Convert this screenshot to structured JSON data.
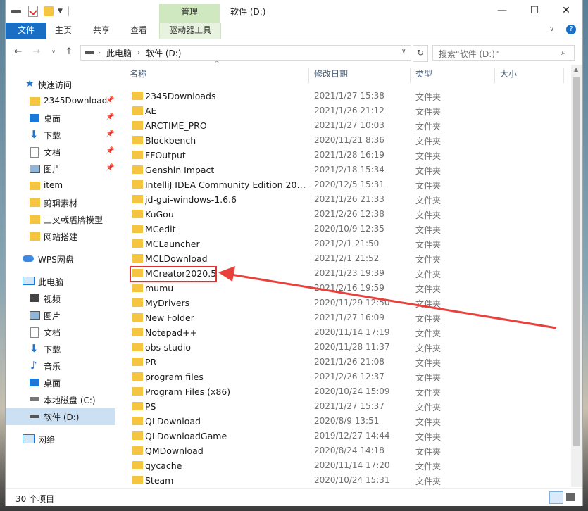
{
  "window": {
    "title": "软件 (D:)",
    "context_tab": "管理",
    "controls": {
      "minimize": "—",
      "maximize": "☐",
      "close": "✕"
    }
  },
  "ribbon": {
    "file": "文件",
    "tabs": [
      "主页",
      "共享",
      "查看"
    ],
    "context_tool": "驱动器工具"
  },
  "address": {
    "path": [
      "此电脑",
      "软件 (D:)"
    ],
    "search_placeholder": "搜索\"软件 (D:)\""
  },
  "nav": {
    "quick_access": "快速访问",
    "quick_items": [
      {
        "label": "2345Download",
        "pinned": true
      },
      {
        "label": "桌面",
        "pinned": true
      },
      {
        "label": "下载",
        "pinned": true
      },
      {
        "label": "文档",
        "pinned": true
      },
      {
        "label": "图片",
        "pinned": true
      },
      {
        "label": "item",
        "pinned": false
      },
      {
        "label": "剪辑素材",
        "pinned": false
      },
      {
        "label": "三叉戟盾牌模型",
        "pinned": false
      },
      {
        "label": "网站搭建",
        "pinned": false
      }
    ],
    "wps": "WPS网盘",
    "this_pc": "此电脑",
    "pc_items": [
      "视频",
      "图片",
      "文档",
      "下载",
      "音乐",
      "桌面",
      "本地磁盘 (C:)",
      "软件 (D:)"
    ],
    "network": "网络"
  },
  "columns": {
    "name": "名称",
    "date": "修改日期",
    "type": "类型",
    "size": "大小"
  },
  "files": [
    {
      "name": "2345Downloads",
      "date": "2021/1/27 15:38",
      "type": "文件夹"
    },
    {
      "name": "AE",
      "date": "2021/1/26 21:12",
      "type": "文件夹"
    },
    {
      "name": "ARCTIME_PRO",
      "date": "2021/1/27 10:03",
      "type": "文件夹"
    },
    {
      "name": "Blockbench",
      "date": "2020/11/21 8:36",
      "type": "文件夹"
    },
    {
      "name": "FFOutput",
      "date": "2021/1/28 16:19",
      "type": "文件夹"
    },
    {
      "name": "Genshin Impact",
      "date": "2021/2/18 15:34",
      "type": "文件夹"
    },
    {
      "name": "IntelliJ IDEA Community Edition 2020....",
      "date": "2020/12/5 15:31",
      "type": "文件夹"
    },
    {
      "name": "jd-gui-windows-1.6.6",
      "date": "2021/1/26 21:33",
      "type": "文件夹"
    },
    {
      "name": "KuGou",
      "date": "2021/2/26 12:38",
      "type": "文件夹"
    },
    {
      "name": "MCedit",
      "date": "2020/10/9 12:35",
      "type": "文件夹"
    },
    {
      "name": "MCLauncher",
      "date": "2021/2/1 21:50",
      "type": "文件夹"
    },
    {
      "name": "MCLDownload",
      "date": "2021/2/1 21:52",
      "type": "文件夹"
    },
    {
      "name": "MCreator2020.5",
      "date": "2021/1/23 19:39",
      "type": "文件夹"
    },
    {
      "name": "mumu",
      "date": "2021/2/16 19:59",
      "type": "文件夹"
    },
    {
      "name": "MyDrivers",
      "date": "2020/11/29 12:50",
      "type": "文件夹"
    },
    {
      "name": "New Folder",
      "date": "2021/1/27 16:09",
      "type": "文件夹"
    },
    {
      "name": "Notepad++",
      "date": "2020/11/14 17:19",
      "type": "文件夹"
    },
    {
      "name": "obs-studio",
      "date": "2020/11/28 11:37",
      "type": "文件夹"
    },
    {
      "name": "PR",
      "date": "2021/1/26 21:08",
      "type": "文件夹"
    },
    {
      "name": "program files",
      "date": "2021/2/26 12:37",
      "type": "文件夹"
    },
    {
      "name": "Program Files (x86)",
      "date": "2020/10/24 15:09",
      "type": "文件夹"
    },
    {
      "name": "PS",
      "date": "2021/1/27 15:37",
      "type": "文件夹"
    },
    {
      "name": "QLDownload",
      "date": "2020/8/9 13:51",
      "type": "文件夹"
    },
    {
      "name": "QLDownloadGame",
      "date": "2019/12/27 14:44",
      "type": "文件夹"
    },
    {
      "name": "QMDownload",
      "date": "2020/8/24 14:18",
      "type": "文件夹"
    },
    {
      "name": "qycache",
      "date": "2020/11/14 17:20",
      "type": "文件夹"
    },
    {
      "name": "Steam",
      "date": "2020/10/24 15:31",
      "type": "文件夹"
    }
  ],
  "highlight": {
    "row_name": "MCreator2020.5",
    "color": "#e03030"
  },
  "status": {
    "count": "30 个项目"
  },
  "colors": {
    "accent": "#1a6fc4",
    "context": "#cfe8c0",
    "folder": "#f5c542",
    "selection": "#cce0f4"
  }
}
